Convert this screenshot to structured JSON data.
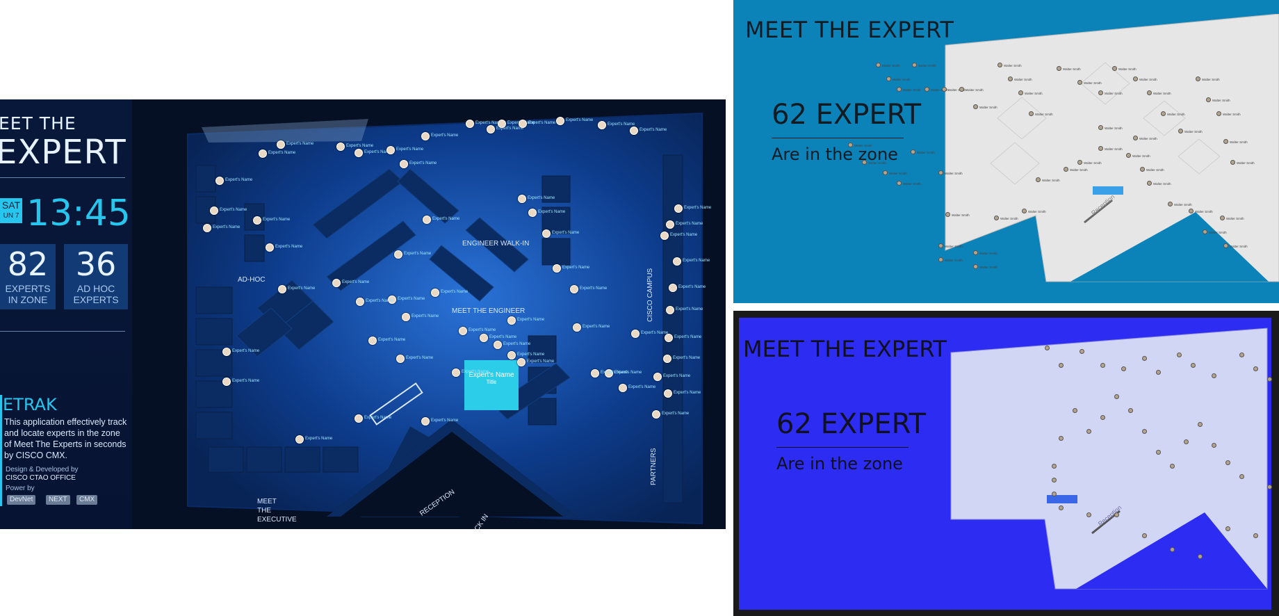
{
  "left_display": {
    "title_line1": "EET THE",
    "title_line2": "EXPERT",
    "day": "SAT",
    "date": "UN 7",
    "clock": "13:45",
    "stat1": {
      "value": "82",
      "label1": "EXPERTS",
      "label2": "IN ZONE"
    },
    "stat2": {
      "value": "36",
      "label1": "AD HOC",
      "label2": "EXPERTS"
    },
    "app_title": "ETRAK",
    "app_description": "This application effectively track and locate experts in the zone of Meet The Experts in seconds by CISCO CMX.",
    "design_label": "Design & Developed by",
    "design_org": "CISCO CTAO OFFICE",
    "power_label": "Power by",
    "power_items": [
      "DevNet",
      "NEXT",
      "CMX"
    ],
    "zones": {
      "ad_hoc": "AD-HOC",
      "engineer_walk_in": "ENGINEER WALK-IN",
      "meet_engineer": "MEET THE ENGINEER",
      "cisco_campus": "CISCO CAMPUS",
      "meet_executive_1": "MEET",
      "meet_executive_2": "THE",
      "meet_executive_3": "EXECUTIVE",
      "partners": "PARTNERS",
      "reception": "RECEPTION",
      "check_in": "CHECK IN"
    },
    "pin_label": "Expert's Name",
    "card_name": "Expert's Name",
    "card_title": "Title"
  },
  "top_right_display": {
    "title": "MEET THE EXPERT",
    "count": "62 EXPERT",
    "subtitle": "Are in the zone",
    "reception": "Reception",
    "pin_label": "Walter Smith"
  },
  "bottom_right_display": {
    "title": "MEET THE EXPERT",
    "count": "62 EXPERT",
    "subtitle": "Are in the zone",
    "reception": "Reception"
  },
  "colors": {
    "accent": "#27c6ee",
    "dark_bg": "#061024",
    "panel_blue": "#0b82b8",
    "screen_blue": "#2c2cf2"
  }
}
